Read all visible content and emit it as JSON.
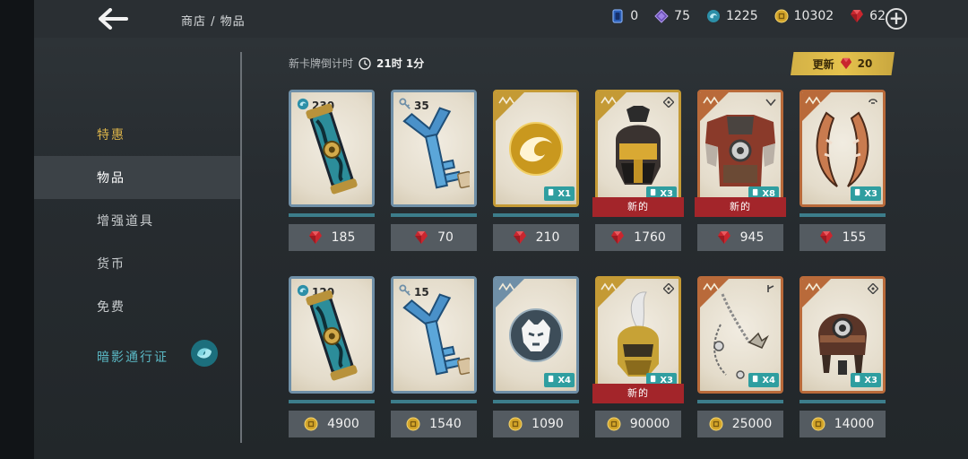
{
  "header": {
    "breadcrumb": "商店 / 物品",
    "currencies": [
      {
        "icon": "card-token-icon",
        "value": "0"
      },
      {
        "icon": "purple-gem-icon",
        "value": "75"
      },
      {
        "icon": "shadow-orb-icon",
        "value": "1225"
      },
      {
        "icon": "gold-coin-icon",
        "value": "10302"
      },
      {
        "icon": "ruby-icon",
        "value": "62"
      }
    ]
  },
  "sidebar": {
    "items": [
      {
        "label": "特惠"
      },
      {
        "label": "物品"
      },
      {
        "label": "增强道具"
      },
      {
        "label": "货币"
      },
      {
        "label": "免费"
      },
      {
        "label": "暗影通行证"
      }
    ]
  },
  "countdown": {
    "label": "新卡牌倒计时",
    "time": "21时 1分"
  },
  "refresh": {
    "label": "更新",
    "cost": "20"
  },
  "new_label": "新的",
  "cards": [
    {
      "art": "shadow-capsule",
      "top_qty": "230",
      "multiplier": "",
      "price": "185",
      "currency": "ruby"
    },
    {
      "art": "key",
      "top_qty": "35",
      "multiplier": "",
      "price": "70",
      "currency": "ruby"
    },
    {
      "art": "gold-emblem",
      "top_qty": "",
      "multiplier": "X1",
      "price": "210",
      "currency": "ruby"
    },
    {
      "art": "gold-helmet",
      "top_qty": "",
      "multiplier": "X3",
      "price": "1760",
      "currency": "ruby",
      "is_new": true
    },
    {
      "art": "armor",
      "top_qty": "",
      "multiplier": "X8",
      "price": "945",
      "currency": "ruby",
      "is_new": true
    },
    {
      "art": "sickle-blades",
      "top_qty": "",
      "multiplier": "X3",
      "price": "155",
      "currency": "ruby"
    },
    {
      "art": "shadow-capsule",
      "top_qty": "120",
      "multiplier": "",
      "price": "4900",
      "currency": "coin"
    },
    {
      "art": "key",
      "top_qty": "15",
      "multiplier": "",
      "price": "1540",
      "currency": "coin"
    },
    {
      "art": "tiger-emblem",
      "top_qty": "",
      "multiplier": "X4",
      "price": "1090",
      "currency": "coin"
    },
    {
      "art": "plumed-helmet",
      "top_qty": "",
      "multiplier": "X3",
      "price": "90000",
      "currency": "coin",
      "is_new": true
    },
    {
      "art": "chain-weapon",
      "top_qty": "",
      "multiplier": "X4",
      "price": "25000",
      "currency": "coin"
    },
    {
      "art": "leather-helmet",
      "top_qty": "",
      "multiplier": "X3",
      "price": "14000",
      "currency": "coin"
    }
  ]
}
